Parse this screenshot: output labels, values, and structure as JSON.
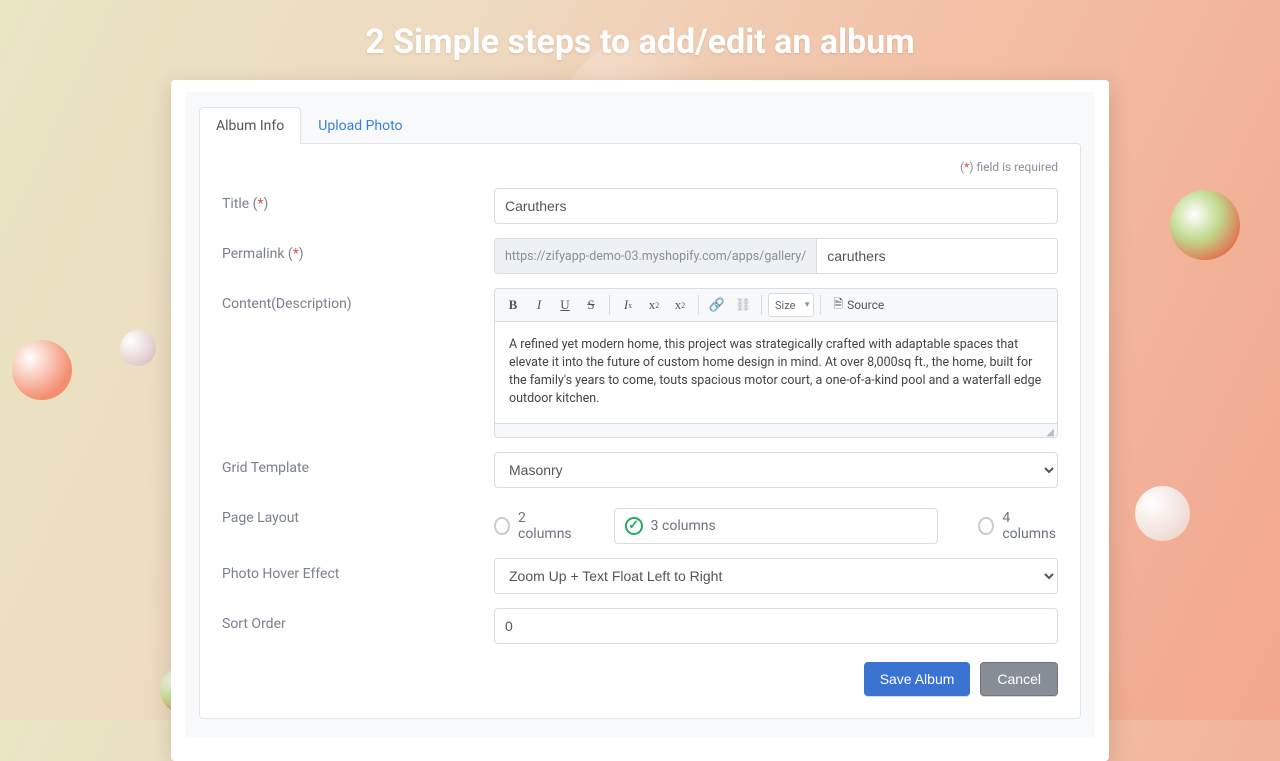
{
  "headline": "2 Simple steps to add/edit an album",
  "tabs": {
    "info": "Album Info",
    "upload": "Upload Photo"
  },
  "required_note_prefix": "(",
  "required_note_ast": "*",
  "required_note_suffix": ") field is required",
  "fields": {
    "title": {
      "label": "Title (",
      "ast": "*",
      "label_end": ")",
      "value": "Caruthers"
    },
    "permalink": {
      "label": "Permalink (",
      "ast": "*",
      "label_end": ")",
      "prefix": "https://zifyapp-demo-03.myshopify.com/apps/gallery/",
      "value": "caruthers"
    },
    "content": {
      "label": "Content(Description)",
      "body": "A refined yet modern home, this project was strategically crafted with adaptable spaces that elevate it into the future of custom home design in mind. At over 8,000sq ft., the home, built for the family's years to come, touts spacious motor court, a one-of-a-kind pool and a waterfall edge outdoor kitchen."
    },
    "grid": {
      "label": "Grid Template",
      "value": "Masonry"
    },
    "layout": {
      "label": "Page Layout",
      "options": {
        "two": "2 columns",
        "three": "3 columns",
        "four": "4 columns"
      }
    },
    "hover": {
      "label": "Photo Hover Effect",
      "value": "Zoom Up + Text Float Left to Right"
    },
    "sort": {
      "label": "Sort Order",
      "value": "0"
    }
  },
  "toolbar": {
    "size": "Size",
    "source": "Source"
  },
  "actions": {
    "save": "Save Album",
    "cancel": "Cancel"
  }
}
